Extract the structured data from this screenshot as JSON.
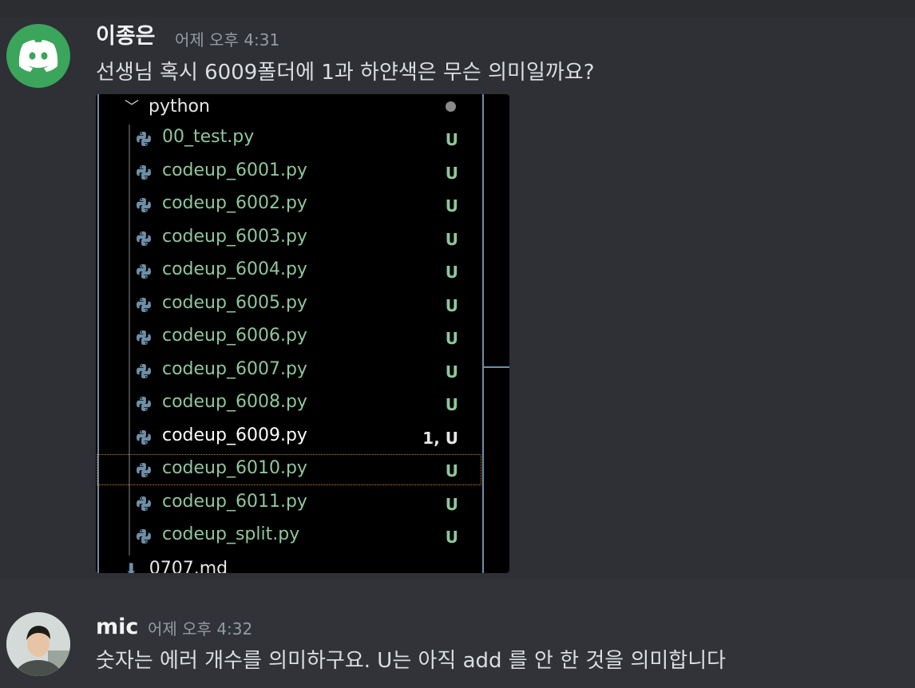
{
  "messages": [
    {
      "author": "이종은",
      "timestamp": "어제 오후 4:31",
      "text": "선생님 혹시 6009폴더에 1과 하얀색은 무슨 의미일까요?",
      "avatar": "discord-logo-icon",
      "attachment": {
        "folder": "python",
        "files": [
          {
            "name": "00_test.py",
            "badge": "U"
          },
          {
            "name": "codeup_6001.py",
            "badge": "U"
          },
          {
            "name": "codeup_6002.py",
            "badge": "U"
          },
          {
            "name": "codeup_6003.py",
            "badge": "U"
          },
          {
            "name": "codeup_6004.py",
            "badge": "U"
          },
          {
            "name": "codeup_6005.py",
            "badge": "U"
          },
          {
            "name": "codeup_6006.py",
            "badge": "U"
          },
          {
            "name": "codeup_6007.py",
            "badge": "U"
          },
          {
            "name": "codeup_6008.py",
            "badge": "U"
          },
          {
            "name": "codeup_6009.py",
            "badge": "1, U"
          },
          {
            "name": "codeup_6010.py",
            "badge": "U"
          },
          {
            "name": "codeup_6011.py",
            "badge": "U"
          },
          {
            "name": "codeup_split.py",
            "badge": "U"
          }
        ],
        "next_item": "0707.md"
      }
    },
    {
      "author": "mic",
      "timestamp": "어제 오후 4:32",
      "text": "숫자는 에러 개수를 의미하구요. U는 아직 add 를 안 한 것을 의미합니다",
      "avatar": "user-photo"
    }
  ],
  "colors": {
    "background": "#313338",
    "untracked_file": "#8fc69b",
    "error_file": "#ffffff",
    "discord_green": "#3ba55c"
  }
}
